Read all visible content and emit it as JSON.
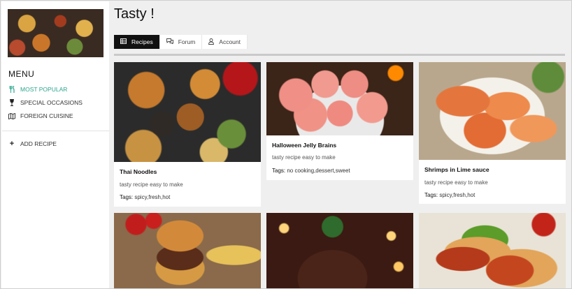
{
  "app": {
    "title": "Tasty !"
  },
  "sidebar": {
    "menu_title": "MENU",
    "items": [
      {
        "label": "MOST POPULAR",
        "icon": "cutlery-icon",
        "active": true
      },
      {
        "label": "SPECIAL OCCASIONS",
        "icon": "wine-glass-icon",
        "active": false
      },
      {
        "label": "FOREIGN CUISINE",
        "icon": "map-icon",
        "active": false
      }
    ],
    "add_recipe": {
      "label": "ADD RECIPE",
      "icon": "plus-icon"
    }
  },
  "tabs": [
    {
      "label": "Recipes",
      "icon": "list-icon",
      "active": true
    },
    {
      "label": "Forum",
      "icon": "chat-icon",
      "active": false
    },
    {
      "label": "Account",
      "icon": "user-icon",
      "active": false
    }
  ],
  "colors": {
    "accent": "#2aa58c",
    "active_tab": "#111111"
  },
  "recipes": [
    {
      "title": "Thai Noodles",
      "description": "tasty recipe easy to make",
      "tags_label": "Tags:",
      "tags": "spicy,fresh,hot"
    },
    {
      "title": "Halloween Jelly Brains",
      "description": "tasty recipe easy to make",
      "tags_label": "Tags:",
      "tags": "no cooking,dessert,sweet"
    },
    {
      "title": "Shrimps in Lime sauce",
      "description": "tasty recipe easy to make",
      "tags_label": "Tags:",
      "tags": "spicy,fresh,hot"
    }
  ]
}
